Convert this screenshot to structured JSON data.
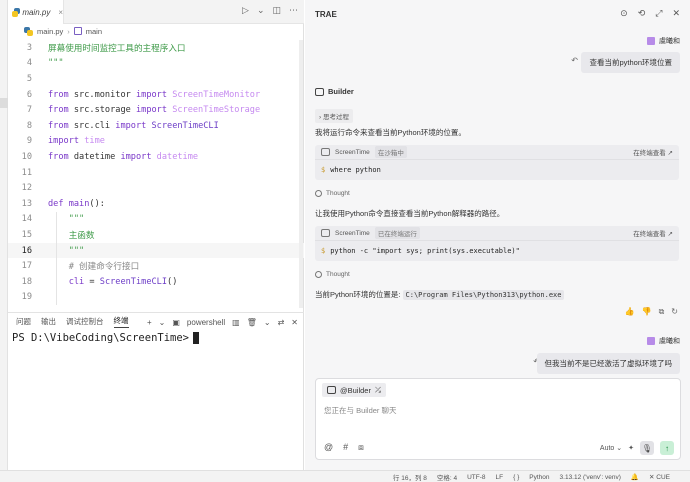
{
  "editor": {
    "tab_label": "main.py",
    "tab_close": "×",
    "tools": [
      "▷",
      "⌄",
      "◫",
      "⋯"
    ],
    "breadcrumb": {
      "file": "main.py",
      "separator": "›",
      "symbol": "main"
    },
    "lines": [
      {
        "n": "3",
        "parts": [
          [
            "g",
            "屏幕使用时间监控工具的主程序入口"
          ]
        ]
      },
      {
        "n": "4",
        "parts": [
          [
            "g",
            "\"\"\""
          ]
        ]
      },
      {
        "n": "5",
        "parts": []
      },
      {
        "n": "6",
        "parts": [
          [
            "kw",
            "from "
          ],
          [
            "mod",
            "src.monitor "
          ],
          [
            "kw",
            "import "
          ],
          [
            "cls",
            "ScreenTimeMonitor"
          ]
        ]
      },
      {
        "n": "7",
        "parts": [
          [
            "kw",
            "from "
          ],
          [
            "mod",
            "src.storage "
          ],
          [
            "kw",
            "import "
          ],
          [
            "cls",
            "ScreenTimeStorage"
          ]
        ]
      },
      {
        "n": "8",
        "parts": [
          [
            "kw",
            "from "
          ],
          [
            "mod",
            "src.cli "
          ],
          [
            "kw",
            "import "
          ],
          [
            "cls2",
            "ScreenTimeCLI"
          ]
        ]
      },
      {
        "n": "9",
        "parts": [
          [
            "kw",
            "import "
          ],
          [
            "cls",
            "time"
          ]
        ]
      },
      {
        "n": "10",
        "parts": [
          [
            "kw",
            "from "
          ],
          [
            "mod",
            "datetime "
          ],
          [
            "kw",
            "import "
          ],
          [
            "cls",
            "datetime"
          ]
        ]
      },
      {
        "n": "11",
        "parts": []
      },
      {
        "n": "12",
        "parts": []
      },
      {
        "n": "13",
        "parts": [
          [
            "kw",
            "def "
          ],
          [
            "fn",
            "main"
          ],
          [
            "mod",
            "():"
          ]
        ]
      },
      {
        "n": "14",
        "parts": [
          [
            "g",
            "    \"\"\""
          ]
        ]
      },
      {
        "n": "15",
        "parts": [
          [
            "g",
            "    主函数"
          ]
        ]
      },
      {
        "n": "16",
        "parts": [
          [
            "g",
            "    \"\"\""
          ]
        ],
        "current": true
      },
      {
        "n": "17",
        "parts": [
          [
            "cmt",
            "    # 创建命令行接口"
          ]
        ]
      },
      {
        "n": "18",
        "parts": [
          [
            "kw",
            "    cli "
          ],
          [
            "mod",
            "= "
          ],
          [
            "cls2",
            "ScreenTimeCLI"
          ],
          [
            "mod",
            "()"
          ]
        ]
      },
      {
        "n": "19",
        "parts": []
      }
    ]
  },
  "terminal": {
    "tabs": [
      "问题",
      "输出",
      "调试控制台",
      "终端"
    ],
    "active_tab": "终端",
    "tools": [
      "+",
      "⌄",
      "▣",
      "powershell",
      "▥",
      "🗑",
      "⌄",
      "⇄",
      "✕"
    ],
    "prompt": "PS D:\\VibeCoding\\ScreenTime>"
  },
  "chat": {
    "title": "TRAE",
    "header_tools": [
      "⊙",
      "⟲",
      "⤢",
      "✕"
    ],
    "user_name": "虞曦和",
    "messages": {
      "user1": "查看当前python环境位置",
      "builder_name": "Builder",
      "thinking_chip": "› 思考过程",
      "reply1": "我将运行命令来查看当前Python环境的位置。",
      "cmd1": {
        "label": "ScreenTime",
        "status": "在沙箱中",
        "open": "在终端查看 ↗",
        "cmd": "where python"
      },
      "thought_label": "Thought",
      "reply2": "让我使用Python命令直接查看当前Python解释器的路径。",
      "cmd2": {
        "label": "ScreenTime",
        "status": "已在终端运行",
        "open": "在终端查看 ↗",
        "cmd": "python -c \"import sys; print(sys.executable)\""
      },
      "thought2_label": "Thought",
      "reply3_prefix": "当前Python环境的位置是:",
      "reply3_path": "C:\\Program Files\\Python313\\python.exe",
      "feedback_icons": [
        "👍",
        "👎",
        "⧉",
        "↻"
      ],
      "user2": "但我当前不是已经激活了虚拟环境了吗"
    },
    "input": {
      "mention": "@Builder",
      "mention_icon": "⤰",
      "placeholder": "您正在与 Builder 聊天",
      "tools": [
        "@",
        "#",
        "⧈"
      ],
      "mode": "Auto ⌄",
      "extra": "✦",
      "mic": "🎙",
      "send": "↑"
    }
  },
  "status": {
    "items": [
      "行 16，列 8",
      "空格: 4",
      "UTF-8",
      "LF",
      "{ }",
      "Python",
      "3.13.12 ('venv': venv)",
      "🔔",
      "✕ CUE"
    ]
  }
}
